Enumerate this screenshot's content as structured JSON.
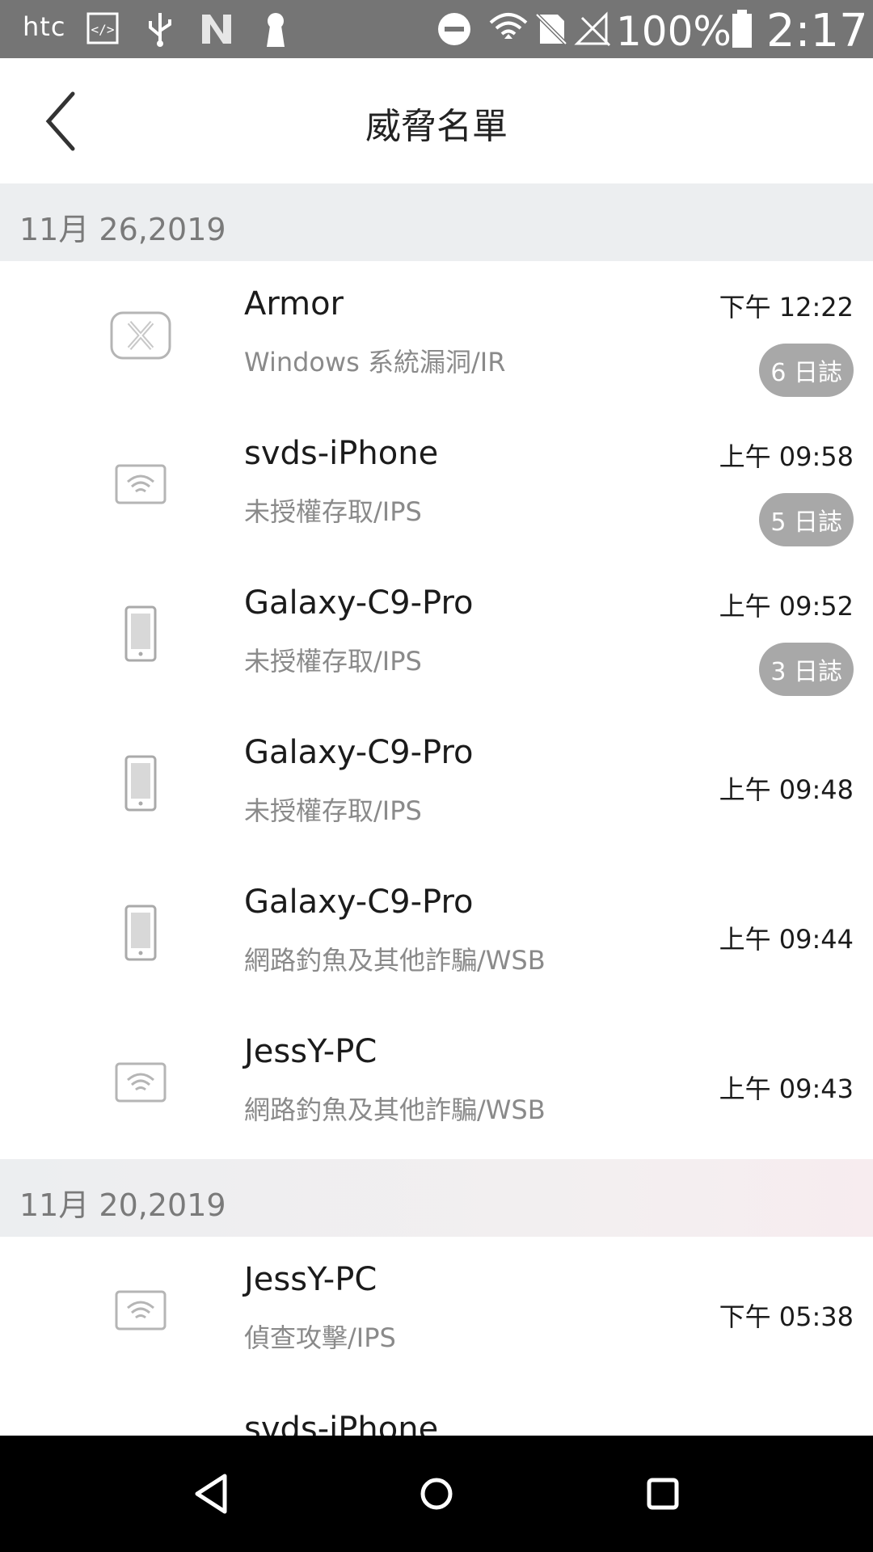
{
  "status_bar": {
    "brand": "htc",
    "battery_text": "100%",
    "time": "2:17",
    "icons": [
      "developer-icon",
      "usb-icon",
      "n-icon",
      "keyhole-icon",
      "dnd-icon",
      "wifi-icon",
      "no-sim-icon",
      "no-signal-icon",
      "battery-icon"
    ]
  },
  "header": {
    "title": "威脅名單",
    "back_icon": "chevron-left-icon"
  },
  "sections": [
    {
      "date": "11月 26,2019",
      "items": [
        {
          "icon": "router-x-icon",
          "name": "Armor",
          "desc": "Windows 系統漏洞/IR",
          "time": "下午 12:22",
          "badge": "6 日誌"
        },
        {
          "icon": "wifi-device-icon",
          "name": "svds-iPhone",
          "desc": "未授權存取/IPS",
          "time": "上午 09:58",
          "badge": "5 日誌"
        },
        {
          "icon": "phone-icon",
          "name": "Galaxy-C9-Pro",
          "desc": "未授權存取/IPS",
          "time": "上午 09:52",
          "badge": "3 日誌"
        },
        {
          "icon": "phone-icon",
          "name": "Galaxy-C9-Pro",
          "desc": "未授權存取/IPS",
          "time": "上午 09:48"
        },
        {
          "icon": "phone-icon",
          "name": "Galaxy-C9-Pro",
          "desc": "網路釣魚及其他詐騙/WSB",
          "time": "上午 09:44"
        },
        {
          "icon": "wifi-device-icon",
          "name": "JessY-PC",
          "desc": "網路釣魚及其他詐騙/WSB",
          "time": "上午 09:43"
        }
      ]
    },
    {
      "date": "11月 20,2019",
      "items": [
        {
          "icon": "wifi-device-icon",
          "name": "JessY-PC",
          "desc": "偵查攻擊/IPS",
          "time": "下午 05:38"
        },
        {
          "icon": "wifi-device-icon",
          "name": "svds-iPhone",
          "desc": "",
          "time": ""
        }
      ]
    }
  ],
  "nav_bar": {
    "back": "nav-back-icon",
    "home": "nav-home-icon",
    "recents": "nav-recents-icon"
  }
}
